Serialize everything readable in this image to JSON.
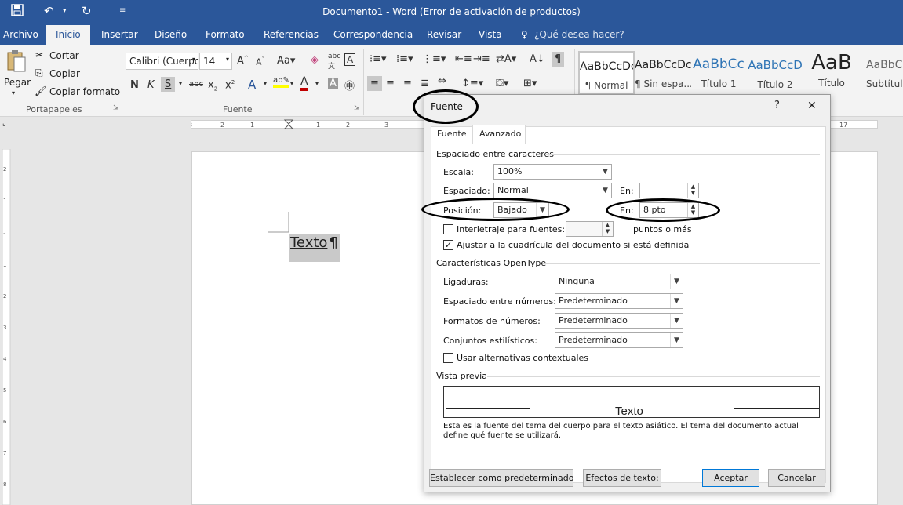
{
  "window": {
    "title": "Documento1 - Word (Error de activación de productos)"
  },
  "quick_access": {
    "icons": [
      "save-icon",
      "undo-icon",
      "redo-icon",
      "customize-icon"
    ]
  },
  "ribbon_tabs": [
    {
      "label": "Archivo"
    },
    {
      "label": "Inicio",
      "active": true
    },
    {
      "label": "Insertar"
    },
    {
      "label": "Diseño"
    },
    {
      "label": "Formato"
    },
    {
      "label": "Referencias"
    },
    {
      "label": "Correspondencia"
    },
    {
      "label": "Revisar"
    },
    {
      "label": "Vista"
    }
  ],
  "tell_me": "¿Qué desea hacer?",
  "clipboard": {
    "paste": "Pegar",
    "cut": "Cortar",
    "copy": "Copiar",
    "format_painter": "Copiar formato",
    "group_label": "Portapapeles"
  },
  "font_group": {
    "font_name": "Calibri (Cuerpo",
    "font_size": "14",
    "group_label": "Fuente"
  },
  "styles": [
    {
      "sample": "AaBbCcDc",
      "name": "¶ Normal"
    },
    {
      "sample": "AaBbCcDc",
      "name": "¶ Sin espa..."
    },
    {
      "sample": "AaBbCc",
      "name": "Título 1"
    },
    {
      "sample": "AaBbCcD",
      "name": "Título 2"
    },
    {
      "sample": "AaB",
      "name": "Título"
    },
    {
      "sample": "AaBbCc",
      "name": "Subtítulo"
    }
  ],
  "document": {
    "text": "Texto",
    "mark": "¶"
  },
  "dialog": {
    "title": "Fuente",
    "help": "?",
    "close": "✕",
    "tabs": [
      "Fuente",
      "Avanzado"
    ],
    "active_tab": "Avanzado",
    "spacing_section": "Espaciado entre caracteres",
    "scale_label": "Escala:",
    "scale_value": "100%",
    "spacing_label": "Espaciado:",
    "spacing_value": "Normal",
    "spacing_by_label": "En:",
    "spacing_by_value": "",
    "position_label": "Posición:",
    "position_value": "Bajado",
    "position_by_label": "En:",
    "position_by_value": "8 pto",
    "kerning_label": "Interletraje para fuentes:",
    "kerning_checked": false,
    "kerning_value": "",
    "kerning_suffix": "puntos o más",
    "grid_label": "Ajustar a la cuadrícula del documento si está definida",
    "grid_checked": true,
    "opentype_section": "Características OpenType",
    "ligatures_label": "Ligaduras:",
    "ligatures_value": "Ninguna",
    "num_spacing_label": "Espaciado entre números:",
    "num_spacing_value": "Predeterminado",
    "num_forms_label": "Formatos de números:",
    "num_forms_value": "Predeterminado",
    "stylistic_label": "Conjuntos estilísticos:",
    "stylistic_value": "Predeterminado",
    "contextual_label": "Usar alternativas contextuales",
    "contextual_checked": false,
    "preview_section": "Vista previa",
    "preview_text": "Texto",
    "preview_note": "Esta es la fuente del tema del cuerpo para el texto asiático. El tema del documento actual define qué fuente se utilizará.",
    "default_button": "Establecer como predeterminado",
    "effects_button": "Efectos de texto:",
    "ok_button": "Aceptar",
    "cancel_button": "Cancelar"
  },
  "colors": {
    "brand": "#2b579a",
    "highlight": "#ffff00",
    "font_color": "#c00000"
  }
}
